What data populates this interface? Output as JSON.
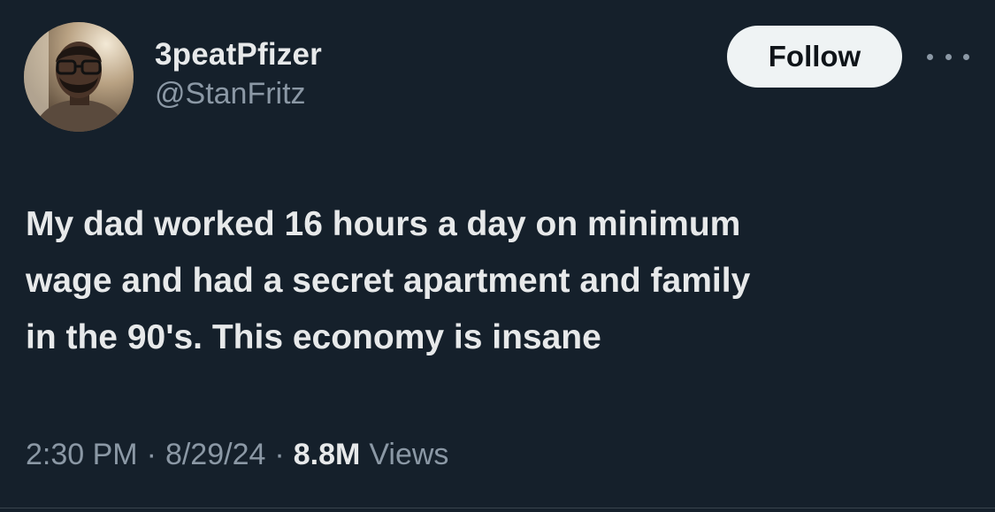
{
  "author": {
    "display_name": "3peatPfizer",
    "handle": "@StanFritz",
    "avatar_icon": "profile-photo"
  },
  "actions": {
    "follow_label": "Follow",
    "more_icon": "more-options-icon"
  },
  "tweet": {
    "text": "My dad worked 16 hours a day on minimum\nwage and had a secret apartment and family\nin the 90's. This economy is insane"
  },
  "meta": {
    "time": "2:30 PM",
    "separator": "·",
    "date": "8/29/24",
    "views_count": "8.8M",
    "views_label": "Views"
  },
  "colors": {
    "background": "#15202b",
    "primary_text": "#e7e9ea",
    "secondary_text": "#8b98a5",
    "follow_button_bg": "#eff3f4",
    "follow_button_text": "#0f1419"
  }
}
